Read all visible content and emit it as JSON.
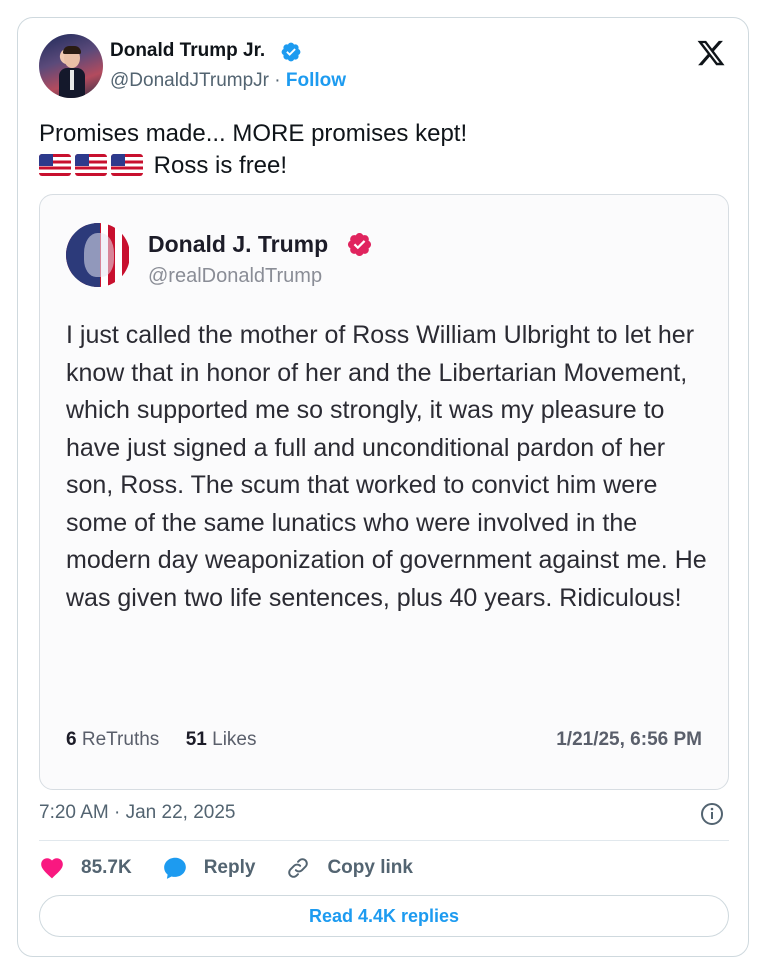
{
  "tweet": {
    "author_name": "Donald Trump Jr.",
    "handle": "@DonaldJTrumpJr",
    "separator": "·",
    "follow_label": "Follow",
    "text_line1": "Promises made... MORE promises kept!",
    "text_line2": "Ross is free!",
    "timestamp": "7:20 AM · Jan 22, 2025"
  },
  "quoted_post": {
    "author_name": "Donald J. Trump",
    "handle": "@realDonaldTrump",
    "body": "I just called the mother of Ross William Ulbright to let her know that in honor of her and the Libertarian Movement, which supported me so strongly, it was my pleasure to have just signed a full and unconditional pardon of her son, Ross. The scum that worked to convict him were some of the same lunatics who were involved in the modern day weaponization of government against me. He was given two life sentences, plus 40 years. Ridiculous!",
    "retruths_count": "6",
    "retruths_label": "ReTruths",
    "likes_count": "51",
    "likes_label": "Likes",
    "date": "1/21/25, 6:56 PM"
  },
  "actions": {
    "like_count": "85.7K",
    "reply_label": "Reply",
    "copy_link_label": "Copy link"
  },
  "read_replies_label": "Read 4.4K replies",
  "icons": {
    "verified": "verified-badge-icon",
    "x_logo": "x-logo-icon",
    "info": "info-icon",
    "heart": "heart-icon",
    "reply": "speech-bubble-icon",
    "link": "link-icon",
    "flag": "us-flag-icon"
  },
  "colors": {
    "accent": "#1d9bf0",
    "like": "#f91880",
    "truth_badge": "#e0245e",
    "text": "#0f1419",
    "secondary": "#536471"
  }
}
